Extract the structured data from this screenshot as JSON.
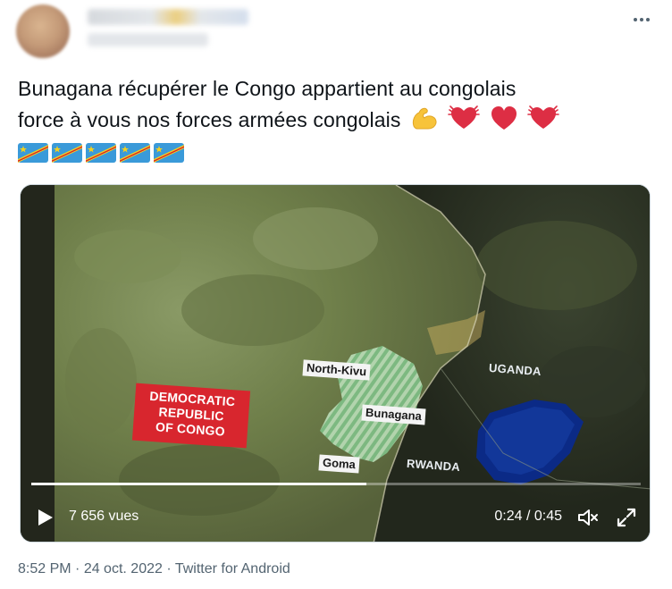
{
  "tweet": {
    "text_line1": "Bunagana récupérer le Congo appartient au congolais",
    "text_line2": "force à vous nos forces armées congolais",
    "emojis": [
      "flexed-biceps",
      "beating-heart",
      "red-heart",
      "beating-heart"
    ],
    "flags": [
      "flag-drc",
      "flag-drc",
      "flag-drc",
      "flag-drc",
      "flag-drc"
    ]
  },
  "video": {
    "views": "7 656 vues",
    "time": "0:24 / 0:45",
    "progress": 0.55,
    "map_labels": {
      "north_kivu": "North-Kivu",
      "bunagana": "Bunagana",
      "goma": "Goma",
      "uganda": "UGANDA",
      "rwanda": "RWANDA",
      "drc_line1": "DEMOCRATIC",
      "drc_line2": "REPUBLIC",
      "drc_line3": "OF CONGO"
    }
  },
  "meta": {
    "time": "8:52 PM",
    "sep1": " · ",
    "date": "24 oct. 2022",
    "sep2": " · ",
    "source": "Twitter for Android"
  },
  "colors": {
    "text": "#0f1419",
    "secondary": "#536471",
    "drc_label": "#d8262e"
  }
}
